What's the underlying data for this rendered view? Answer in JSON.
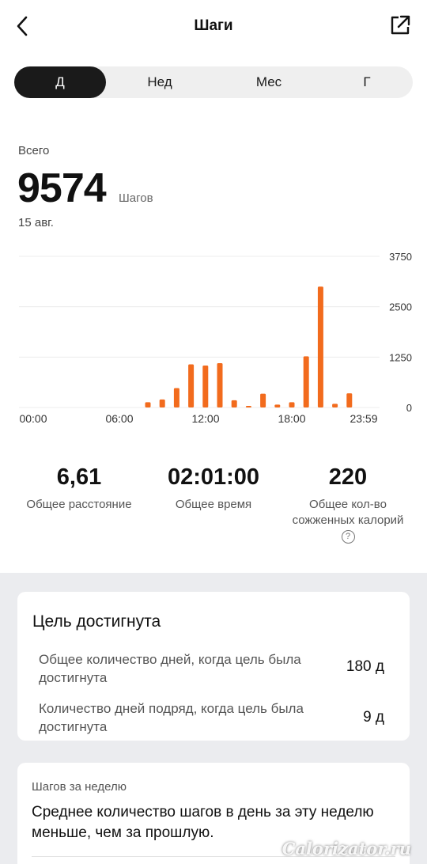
{
  "header": {
    "title": "Шаги",
    "back_icon": "chevron-left-icon",
    "share_icon": "share-export-icon"
  },
  "tabs": [
    {
      "label": "Д",
      "active": true
    },
    {
      "label": "Нед",
      "active": false
    },
    {
      "label": "Мес",
      "active": false
    },
    {
      "label": "Г",
      "active": false
    }
  ],
  "summary": {
    "label": "Всего",
    "value": "9574",
    "unit": "Шагов",
    "date": "15 авг."
  },
  "chart_data": {
    "type": "bar",
    "color": "#f26b1d",
    "x_ticks": [
      "00:00",
      "06:00",
      "12:00",
      "18:00",
      "23:59"
    ],
    "y_ticks": [
      "3750",
      "2500",
      "1250",
      "0"
    ],
    "ylim": [
      0,
      3750
    ],
    "grid": true,
    "hours": [
      0,
      1,
      2,
      3,
      4,
      5,
      6,
      7,
      8,
      9,
      10,
      11,
      12,
      13,
      14,
      15,
      16,
      17,
      18,
      19,
      20,
      21,
      22,
      23
    ],
    "values": [
      0,
      0,
      0,
      0,
      0,
      0,
      0,
      0,
      130,
      200,
      480,
      1070,
      1040,
      1100,
      180,
      30,
      340,
      70,
      130,
      1270,
      3000,
      90,
      350,
      0
    ]
  },
  "stats": [
    {
      "value": "6,61",
      "label": "Общее расстояние"
    },
    {
      "value": "02:01:00",
      "label": "Общее время"
    },
    {
      "value": "220",
      "label": "Общее кол-во сожженных калорий",
      "help": "?"
    }
  ],
  "goal_card": {
    "title": "Цель достигнута",
    "rows": [
      {
        "text": "Общее количество дней, когда цель была достигнута",
        "value": "180 д"
      },
      {
        "text": "Количество дней подряд, когда цель была достигнута",
        "value": "9 д"
      }
    ]
  },
  "week_card": {
    "label": "Шагов за неделю",
    "text": "Среднее количество шагов в день за эту неделю меньше, чем за прошлую."
  },
  "watermark": "Calorizator.ru"
}
